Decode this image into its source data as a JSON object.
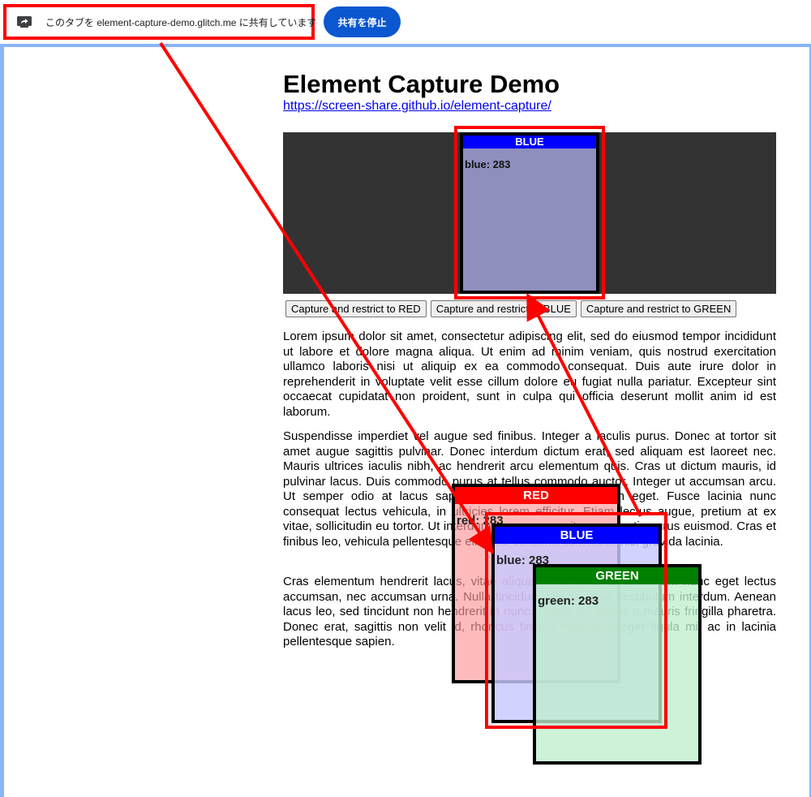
{
  "share_bar": {
    "icon": "screen-share-icon",
    "text": "このタブを element-capture-demo.glitch.me に共有しています",
    "stop_label": "共有を停止"
  },
  "page": {
    "title": "Element Capture Demo",
    "link": "https://screen-share.github.io/element-capture/"
  },
  "capture_area": {
    "blue_panel": {
      "label": "BLUE",
      "value": "blue: 283"
    }
  },
  "buttons": [
    "Capture and restrict to RED",
    "Capture and restrict to BLUE",
    "Capture and restrict to GREEN"
  ],
  "paragraphs": [
    "Lorem ipsum dolor sit amet, consectetur adipiscing elit, sed do eiusmod tempor incididunt ut labore et dolore magna aliqua. Ut enim ad minim veniam, quis nostrud exercitation ullamco laboris nisi ut aliquip ex ea commodo consequat. Duis aute irure dolor in reprehenderit in voluptate velit esse cillum dolore eu fugiat nulla pariatur. Excepteur sint occaecat cupidatat non proident, sunt in culpa qui officia deserunt mollit anim id est laborum.",
    "Suspendisse imperdiet vel augue sed finibus. Integer a iaculis purus. Donec at tortor sit amet augue sagittis pulvinar. Donec interdum dictum erat, sed aliquam est laoreet nec. Mauris ultrices iaculis nibh, ac hendrerit arcu elementum quis. Cras ut dictum mauris, id pulvinar lacus. Duis commodo purus at tellus commodo auctor. Integer ut accumsan arcu. Ut semper odio at lacus sapien, sed ultricies sem rutrum eget. Fusce lacinia nunc consequat lectus vehicula, in ultricies lorem efficitur. Etiam lectus augue, pretium at ex vitae, sollicitudin eu tortor. Ut interdum ipsum nunc, vitae venenatis purus euismod. Cras et finibus leo, vehicula pellentesque elit. Sed condimentum lacus nisl gravida lacinia.",
    "Cras elementum hendrerit lacus, vitae aliquam nisi. Sed condimentum nunc eget lectus accumsan, nec accumsan urna. Nulla tincidunt nisi sit amet vestibulum interdum. Aenean lacus leo, sed tincidunt non hendrerit in nunc. Fusce vel metus a mauris fringilla pharetra. Donec erat, sagittis non velit id, rhoncus finibus magna. Integer ligula mi, ac in lacinia pellentesque sapien."
  ],
  "floating_panels": {
    "red": {
      "label": "RED",
      "value": "red: 283",
      "color": "#ff0000"
    },
    "blue": {
      "label": "BLUE",
      "value": "blue: 283",
      "color": "#0000ff"
    },
    "green": {
      "label": "GREEN",
      "value": "green: 283",
      "color": "#008000"
    }
  },
  "colors": {
    "annotation": "#ff0000",
    "stop_button": "#0b57d0",
    "capture_bg": "#333333",
    "page_border": "#8ab4f8"
  }
}
